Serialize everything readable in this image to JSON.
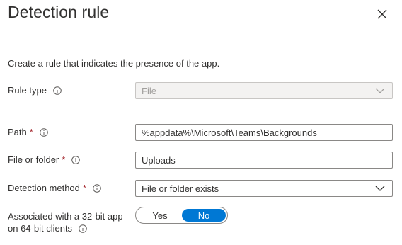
{
  "panel": {
    "title": "Detection rule"
  },
  "description": "Create a rule that indicates the presence of the app.",
  "rule_type": {
    "label": "Rule type",
    "value": "File"
  },
  "path": {
    "label": "Path",
    "required_mark": "*",
    "value": "%appdata%\\Microsoft\\Teams\\Backgrounds"
  },
  "file_or_folder": {
    "label": "File or folder",
    "required_mark": "*",
    "value": "Uploads"
  },
  "detection_method": {
    "label": "Detection method",
    "required_mark": "*",
    "value": "File or folder exists"
  },
  "associated": {
    "label_line1": "Associated with a 32-bit app",
    "label_line2": "on 64-bit clients",
    "yes_label": "Yes",
    "no_label": "No",
    "selected": "No"
  },
  "colors": {
    "accent": "#0078d4",
    "required": "#a4262c",
    "border": "#8a8886"
  }
}
